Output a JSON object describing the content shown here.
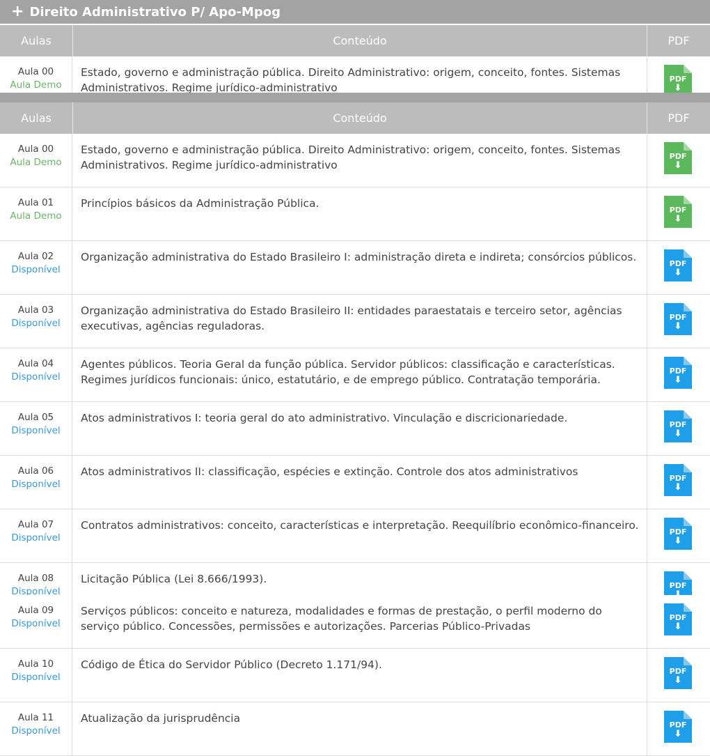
{
  "course": {
    "title": "Direito Administrativo P/ Apo-Mpog",
    "plus_symbol": "+"
  },
  "table": {
    "headers": {
      "aulas": "Aulas",
      "conteudo": "Conteúdo",
      "pdf": "PDF"
    },
    "pdf_label": "PDF",
    "rows": [
      {
        "aula": "Aula 00",
        "status": "Aula Demo",
        "status_type": "demo",
        "conteudo": "Estado, governo e administração pública. Direito Administrativo: origem, conceito, fontes. Sistemas Administrativos. Regime jurídico-administrativo"
      },
      {
        "aula": "Aula 01",
        "status": "Aula Demo",
        "status_type": "demo",
        "conteudo": "Princípios básicos da Administração Pública."
      },
      {
        "aula": "Aula 02",
        "status": "Disponível",
        "status_type": "disp",
        "conteudo": "Organização administrativa do Estado Brasileiro I: administração direta e indireta; consórcios públicos."
      },
      {
        "aula": "Aula 03",
        "status": "Disponível",
        "status_type": "disp",
        "conteudo": "Organização administrativa do Estado Brasileiro II: entidades paraestatais e terceiro setor, agências executivas, agências reguladoras."
      },
      {
        "aula": "Aula 04",
        "status": "Disponível",
        "status_type": "disp",
        "conteudo": "Agentes públicos. Teoria Geral da função pública. Servidor públicos: classificação e características. Regimes jurídicos funcionais: único, estatutário, e de emprego público. Contratação temporária."
      },
      {
        "aula": "Aula 05",
        "status": "Disponível",
        "status_type": "disp",
        "conteudo": "Atos administrativos I: teoria geral do ato administrativo. Vinculação e discricionariedade."
      },
      {
        "aula": "Aula 06",
        "status": "Disponível",
        "status_type": "disp",
        "conteudo": "Atos administrativos II: classificação, espécies e extinção. Controle dos atos administrativos"
      },
      {
        "aula": "Aula 07",
        "status": "Disponível",
        "status_type": "disp",
        "conteudo": "Contratos administrativos: conceito, características e interpretação. Reequilíbrio econômico-financeiro."
      },
      {
        "aula": "Aula 08",
        "status": "Disponível",
        "status_type": "disp",
        "conteudo": "Licitação Pública (Lei 8.666/1993)."
      },
      {
        "aula": "Aula 09",
        "status": "Disponível",
        "status_type": "disp",
        "conteudo": "Serviços públicos: conceito e natureza, modalidades e formas de prestação, o perfil moderno do serviço público. Concessões, permissões e autorizações. Parcerias Público-Privadas"
      },
      {
        "aula": "Aula 10",
        "status": "Disponível",
        "status_type": "disp",
        "conteudo": "Código de Ética do Servidor Público (Decreto 1.171/94)."
      },
      {
        "aula": "Aula 11",
        "status": "Disponível",
        "status_type": "disp",
        "conteudo": "Atualização da jurisprudência"
      }
    ]
  },
  "colors": {
    "title_bar": "#a3a3a3",
    "header_bar": "#bcbcbc",
    "demo_green": "#5cb85c",
    "available_blue": "#1e9fe8"
  }
}
